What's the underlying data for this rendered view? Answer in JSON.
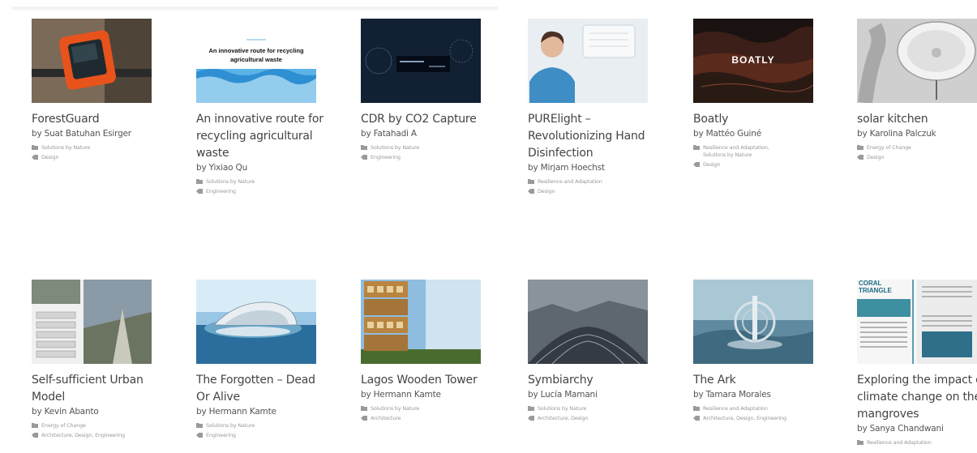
{
  "projects": [
    {
      "title": "ForestGuard",
      "author": "by Suat Batuhan Esirger",
      "category": "Solutions by Nature",
      "tags": "Design"
    },
    {
      "title": "An innovative route for recycling agricultural waste",
      "author": "by Yixiao Qu",
      "category": "Solutions by Nature",
      "tags": "Engineering",
      "thumb_text": "An innovative route for recycling agricultural waste"
    },
    {
      "title": "CDR by CO2 Capture",
      "author": "by Fatahadi A",
      "category": "Solutions by Nature",
      "tags": "Engineering"
    },
    {
      "title": "PURElight – Revolutionizing Hand Disinfection",
      "author": "by Mirjam Hoechst",
      "category": "Resilience and Adaptation",
      "tags": "Design"
    },
    {
      "title": "Boatly",
      "author": "by Mattéo Guiné",
      "category": "Resilience and Adaptation, Solutions by Nature",
      "tags": "Design",
      "thumb_text": "BOATLY"
    },
    {
      "title": "solar kitchen",
      "author": "by Karolina Palczuk",
      "category": "Energy of Change",
      "tags": "Design"
    },
    {
      "title": "Self-sufficient Urban Model",
      "author": "by Kevin Abanto",
      "category": "Energy of Change",
      "tags": "Architecture, Design, Engineering"
    },
    {
      "title": "The Forgotten – Dead Or Alive",
      "author": "by Hermann Kamte",
      "category": "Solutions by Nature",
      "tags": "Engineering"
    },
    {
      "title": "Lagos Wooden Tower",
      "author": "by Hermann Kamte",
      "category": "Solutions by Nature",
      "tags": "Architecture"
    },
    {
      "title": "Symbiarchy",
      "author": "by Lucía Mamani",
      "category": "Solutions by Nature",
      "tags": "Architecture, Design"
    },
    {
      "title": "The Ark",
      "author": "by Tamara Morales",
      "category": "Resilience and Adaptation",
      "tags": "Architecture, Design, Engineering"
    },
    {
      "title": "Exploring the impact of climate change on the mangroves",
      "author": "by Sanya Chandwani",
      "category": "Resilience and Adaptation",
      "thumb_text": "CORAL TRIANGLE"
    }
  ]
}
